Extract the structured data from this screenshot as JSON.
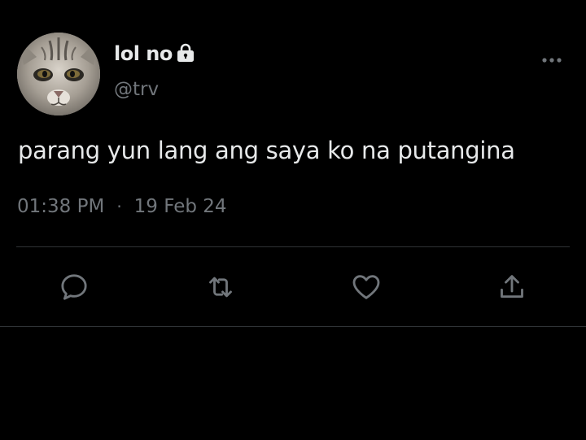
{
  "tweet": {
    "display_name": "lol no",
    "handle": "@trv",
    "text": "parang yun lang ang saya ko na putangina",
    "time": "01:38 PM",
    "separator": "·",
    "date": "19 Feb 24"
  },
  "icons": {
    "account": "lock-icon",
    "menu": "more-options-icon",
    "reply": "reply-icon",
    "retweet": "retweet-icon",
    "like": "heart-icon",
    "share": "share-icon"
  },
  "colors": {
    "background": "#000000",
    "primary_text": "#e7e9ea",
    "secondary_text": "#71767b",
    "divider": "#2f3336"
  }
}
